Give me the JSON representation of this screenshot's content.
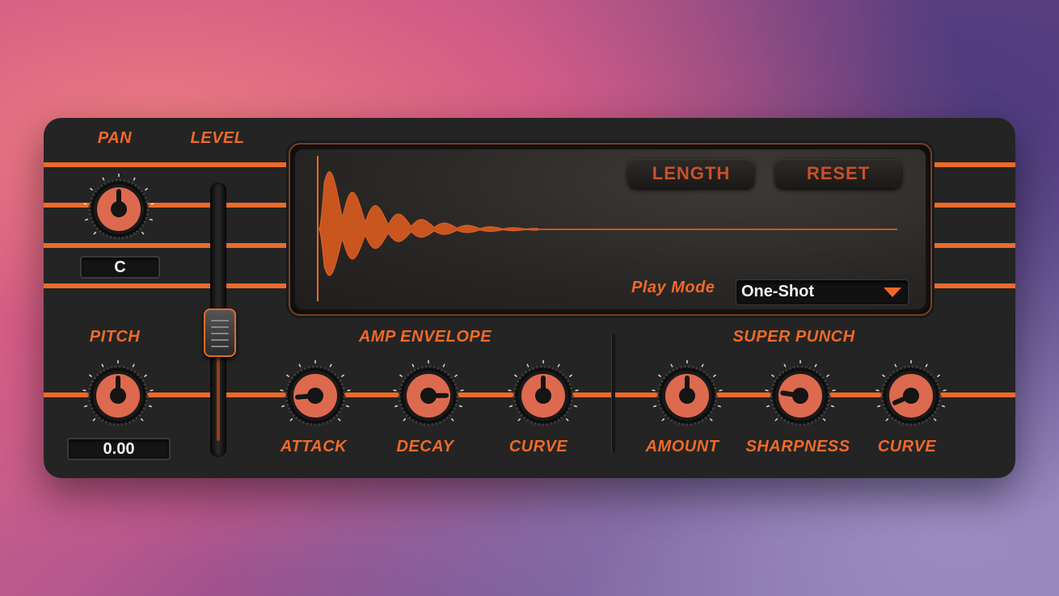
{
  "colors": {
    "accent": "#ed6a2b",
    "knob_face": "#dd6a4e",
    "panel": "#242424"
  },
  "labels": {
    "pan": "PAN",
    "level": "LEVEL",
    "pitch": "PITCH",
    "amp_envelope": "AMP ENVELOPE",
    "super_punch": "SUPER PUNCH",
    "attack": "ATTACK",
    "decay": "DECAY",
    "amp_curve": "CURVE",
    "amount": "AMOUNT",
    "sharpness": "SHARPNESS",
    "punch_curve": "CURVE"
  },
  "readouts": {
    "pan": "C",
    "pitch": "0.00"
  },
  "display": {
    "length_button": "LENGTH",
    "reset_button": "RESET",
    "play_mode_label": "Play Mode",
    "play_mode_value": "One-Shot"
  },
  "level_fraction": 0.45,
  "knobs": {
    "pan": 0.5,
    "pitch": 0.5,
    "attack": 0.15,
    "decay": 0.83,
    "amp_curve": 0.5,
    "amount": 0.5,
    "sharpness": 0.2,
    "punch_curve": 0.08
  },
  "icons": {
    "dropdown": "triangle-down-icon"
  }
}
